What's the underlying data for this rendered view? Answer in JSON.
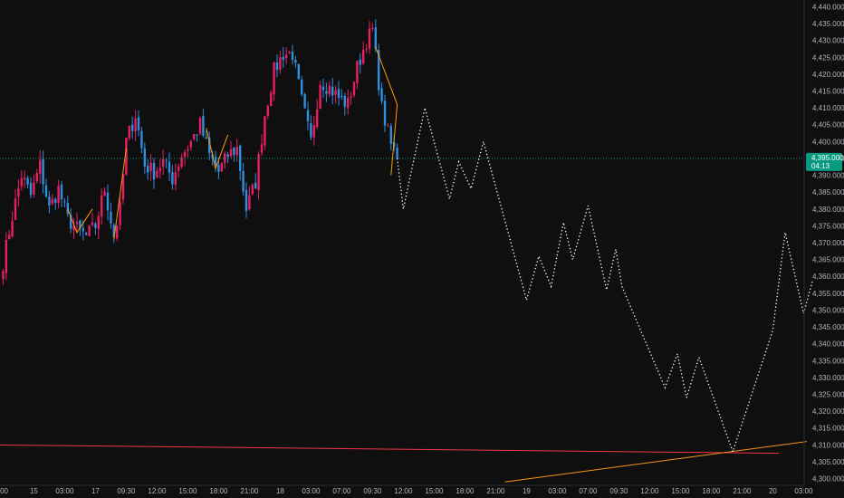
{
  "chart_data": {
    "type": "candlestick",
    "title": "",
    "colors": {
      "background": "#0f0f0f",
      "up": "#e91e63",
      "down": "#2f8fe0",
      "zigzag": "#ff9800",
      "projection": "#ffffff",
      "horizontal_line": "#f23645",
      "trend_line": "#f7931a",
      "current_price": "#089981",
      "axis_text": "#b2b5be"
    },
    "y_axis": {
      "min": 4298,
      "max": 4442,
      "ticks": [
        "4,440.000",
        "4,435.000",
        "4,430.000",
        "4,425.000",
        "4,420.000",
        "4,415.000",
        "4,410.000",
        "4,405.000",
        "4,400.000",
        "4,395.000",
        "4,390.000",
        "4,385.000",
        "4,380.000",
        "4,375.000",
        "4,370.000",
        "4,365.000",
        "4,360.000",
        "4,355.000",
        "4,350.000",
        "4,345.000",
        "4,340.000",
        "4,335.000",
        "4,330.000",
        "4,325.000",
        "4,320.000",
        "4,315.000",
        "4,310.000",
        "4,305.000",
        "4,300.000"
      ]
    },
    "x_axis": {
      "ticks": [
        {
          "i": 0,
          "label": ":00"
        },
        {
          "i": 10,
          "label": "15"
        },
        {
          "i": 20,
          "label": "03:00"
        },
        {
          "i": 30,
          "label": "17"
        },
        {
          "i": 40,
          "label": "09:30"
        },
        {
          "i": 50,
          "label": "12:00"
        },
        {
          "i": 60,
          "label": "15:00"
        },
        {
          "i": 70,
          "label": "18:00"
        },
        {
          "i": 80,
          "label": "21:00"
        },
        {
          "i": 90,
          "label": "18"
        },
        {
          "i": 100,
          "label": "03:00"
        },
        {
          "i": 110,
          "label": "07:00"
        },
        {
          "i": 120,
          "label": "09:30"
        },
        {
          "i": 130,
          "label": "12:00"
        },
        {
          "i": 140,
          "label": "15:00"
        },
        {
          "i": 150,
          "label": "18:00"
        },
        {
          "i": 160,
          "label": "21:00"
        },
        {
          "i": 170,
          "label": "19"
        },
        {
          "i": 180,
          "label": "03:00"
        },
        {
          "i": 190,
          "label": "07:00"
        },
        {
          "i": 200,
          "label": "09:30"
        },
        {
          "i": 210,
          "label": "12:00"
        },
        {
          "i": 220,
          "label": "15:00"
        },
        {
          "i": 230,
          "label": "18:00"
        },
        {
          "i": 240,
          "label": "21:00"
        },
        {
          "i": 250,
          "label": "20"
        },
        {
          "i": 260,
          "label": "03:00"
        }
      ]
    },
    "price_path": [
      [
        0,
        4364
      ],
      [
        3,
        4378
      ],
      [
        6,
        4390
      ],
      [
        9,
        4384
      ],
      [
        12,
        4393
      ],
      [
        15,
        4380
      ],
      [
        18,
        4386
      ],
      [
        21,
        4377
      ],
      [
        24,
        4374
      ],
      [
        27,
        4372
      ],
      [
        30,
        4375
      ],
      [
        33,
        4386
      ],
      [
        36,
        4372
      ],
      [
        38,
        4380
      ],
      [
        40,
        4400
      ],
      [
        43,
        4408
      ],
      [
        46,
        4393
      ],
      [
        49,
        4391
      ],
      [
        52,
        4394
      ],
      [
        55,
        4389
      ],
      [
        58,
        4396
      ],
      [
        61,
        4400
      ],
      [
        64,
        4405
      ],
      [
        67,
        4396
      ],
      [
        70,
        4391
      ],
      [
        73,
        4396
      ],
      [
        76,
        4398
      ],
      [
        79,
        4380
      ],
      [
        82,
        4388
      ],
      [
        85,
        4408
      ],
      [
        88,
        4421
      ],
      [
        91,
        4426
      ],
      [
        94,
        4426
      ],
      [
        97,
        4412
      ],
      [
        100,
        4400
      ],
      [
        103,
        4418
      ],
      [
        106,
        4416
      ],
      [
        109,
        4413
      ],
      [
        112,
        4411
      ],
      [
        115,
        4422
      ],
      [
        118,
        4430
      ],
      [
        120,
        4433
      ],
      [
        123,
        4410
      ],
      [
        126,
        4399
      ],
      [
        128,
        4396
      ]
    ],
    "zigzag_segments": [
      [
        [
          21,
          4380
        ],
        [
          24,
          4373
        ],
        [
          29,
          4380
        ]
      ],
      [
        [
          36,
          4371
        ],
        [
          40,
          4398
        ]
      ],
      [
        [
          66,
          4404
        ],
        [
          69,
          4392
        ],
        [
          73,
          4402
        ]
      ],
      [
        [
          121,
          4428
        ],
        [
          128,
          4411
        ],
        [
          126,
          4390
        ]
      ]
    ],
    "projection": [
      [
        128,
        4395
      ],
      [
        130,
        4380
      ],
      [
        137,
        4410
      ],
      [
        145,
        4383
      ],
      [
        148,
        4394
      ],
      [
        152,
        4386
      ],
      [
        156,
        4400
      ],
      [
        170,
        4353
      ],
      [
        174,
        4366
      ],
      [
        178,
        4357
      ],
      [
        182,
        4376
      ],
      [
        185,
        4365
      ],
      [
        190,
        4381
      ],
      [
        196,
        4356
      ],
      [
        199,
        4368
      ],
      [
        201,
        4357
      ],
      [
        215,
        4327
      ],
      [
        219,
        4337
      ],
      [
        222,
        4324
      ],
      [
        226,
        4336
      ],
      [
        237,
        4308
      ],
      [
        250,
        4344
      ],
      [
        254,
        4373
      ],
      [
        260,
        4349
      ],
      [
        263,
        4359
      ]
    ],
    "horizontal_line": {
      "price": 4310.0,
      "from_i": -5,
      "to_i": 252
    },
    "trend_line": {
      "from": [
        163,
        4299
      ],
      "to": [
        261,
        4311
      ]
    },
    "current_price": {
      "label": "4,395.000",
      "countdown": "04:13",
      "value": 4395.0
    }
  }
}
